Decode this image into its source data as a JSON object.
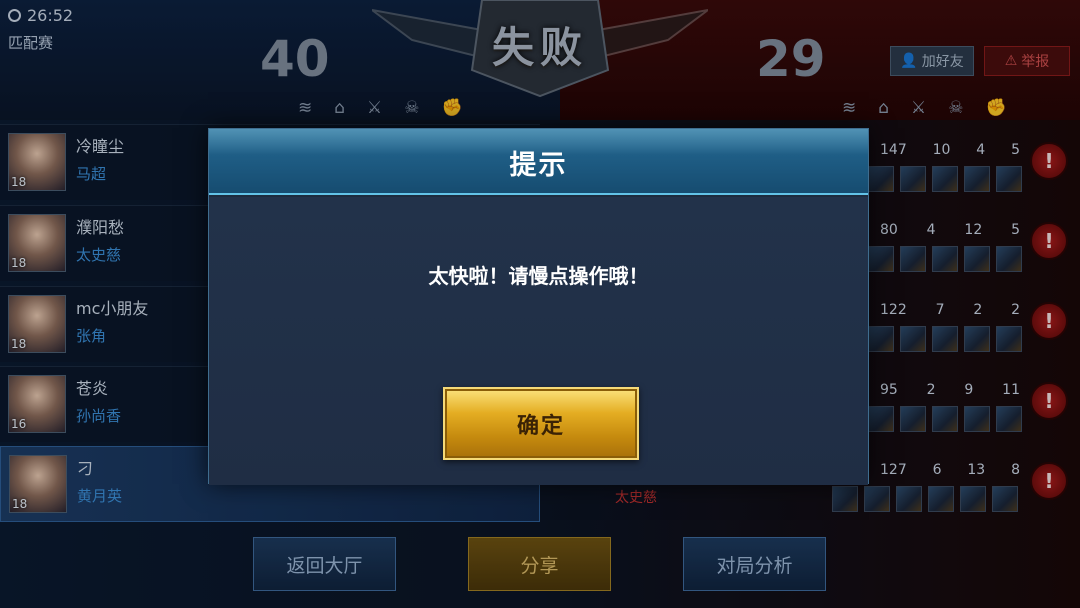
{
  "status": {
    "timer": "26:52",
    "mode": "匹配赛"
  },
  "header": {
    "result": "失败",
    "score_blue": "40",
    "score_red": "29"
  },
  "actions": {
    "add_friend": "加好友",
    "report": "举报"
  },
  "blue_team": [
    {
      "name": "冷瞳尘",
      "hero": "马超",
      "level": "18"
    },
    {
      "name": "濮阳愁",
      "hero": "太史慈",
      "level": "18"
    },
    {
      "name": "mc小朋友",
      "hero": "张角",
      "level": "18"
    },
    {
      "name": "苍炎",
      "hero": "孙尚香",
      "level": "16"
    },
    {
      "name": "刁",
      "hero": "黄月英",
      "level": "18"
    }
  ],
  "red_team_stats": [
    {
      "gold": "147",
      "k": "10",
      "d": "4",
      "a": "5"
    },
    {
      "gold": "80",
      "k": "4",
      "d": "12",
      "a": "5"
    },
    {
      "gold": "122",
      "k": "7",
      "d": "2",
      "a": "2"
    },
    {
      "gold": "95",
      "k": "2",
      "d": "9",
      "a": "11"
    },
    {
      "gold": "127",
      "k": "6",
      "d": "13",
      "a": "8"
    }
  ],
  "red_visible_hero": "太史慈",
  "bottom": {
    "back_lobby": "返回大厅",
    "share": "分享",
    "analysis": "对局分析"
  },
  "modal": {
    "title": "提示",
    "message": "太快啦！请慢点操作哦！",
    "confirm": "确定"
  },
  "alert_glyph": "!"
}
